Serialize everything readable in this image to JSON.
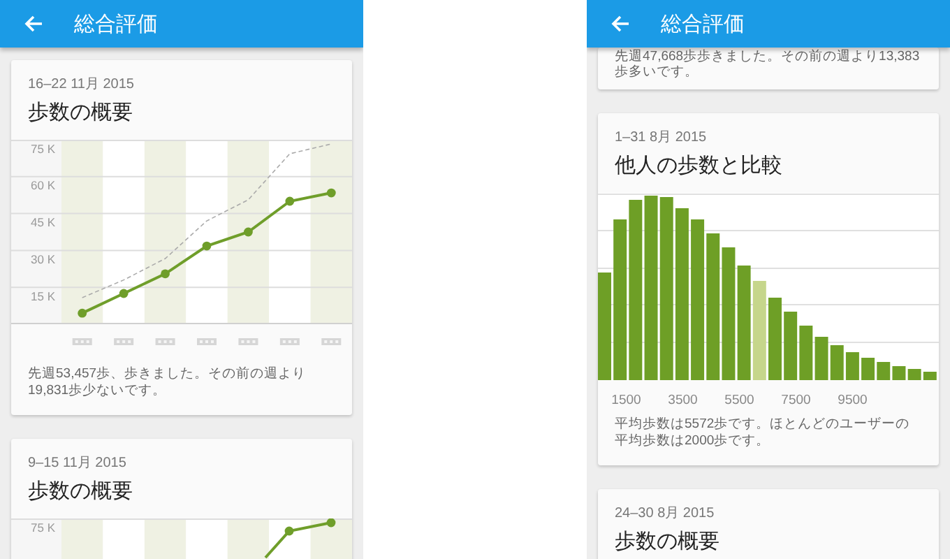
{
  "screens": [
    {
      "title": "総合評価",
      "cards": [
        {
          "kind": "line",
          "date": "16–22 11月 2015",
          "title": "歩数の概要",
          "chart_data": {
            "type": "line",
            "categories": [
              null,
              null,
              null,
              null,
              null,
              null,
              null
            ],
            "grid": true,
            "ylim": [
              0,
              75
            ],
            "yticks": [
              {
                "value": 15,
                "label": "15 K"
              },
              {
                "value": 30,
                "label": "30 K"
              },
              {
                "value": 45,
                "label": "45 K"
              },
              {
                "value": 60,
                "label": "60 K"
              },
              {
                "value": 75,
                "label": "75 K"
              }
            ],
            "series": [
              {
                "color": "#6f9e2a",
                "line_style": "solid",
                "marker": "circle",
                "values": [
                  4.5,
                  12.5,
                  20.5,
                  31.8,
                  37.5,
                  50,
                  53.4
                ]
              },
              {
                "color": "#aaaaaa",
                "line_style": "dashed",
                "values": [
                  10.8,
                  18,
                  26.7,
                  42,
                  50.6,
                  69.3,
                  73.3
                ]
              }
            ]
          },
          "summary": "先週53,457歩、歩きました。その前の週より19,831歩少ないです。"
        },
        {
          "kind": "line_preview",
          "date": "9–15 11月 2015",
          "title": "歩数の概要",
          "y_label": "75 K"
        }
      ]
    },
    {
      "title": "総合評価",
      "cards": [
        {
          "kind": "text",
          "summary": "先週47,668歩歩きました。その前の週より13,383歩多いです。"
        },
        {
          "kind": "histogram",
          "date": "1–31 8月 2015",
          "title": "他人の歩数と比較",
          "x_labels": [
            "1500",
            "3500",
            "5500",
            "7500",
            "9500"
          ],
          "summary": "平均歩数は5572歩です。ほとんどのユーザーの平均歩数は2000歩です。"
        },
        {
          "kind": "title",
          "date": "24–30 8月 2015",
          "title": "歩数の概要"
        }
      ]
    }
  ]
}
